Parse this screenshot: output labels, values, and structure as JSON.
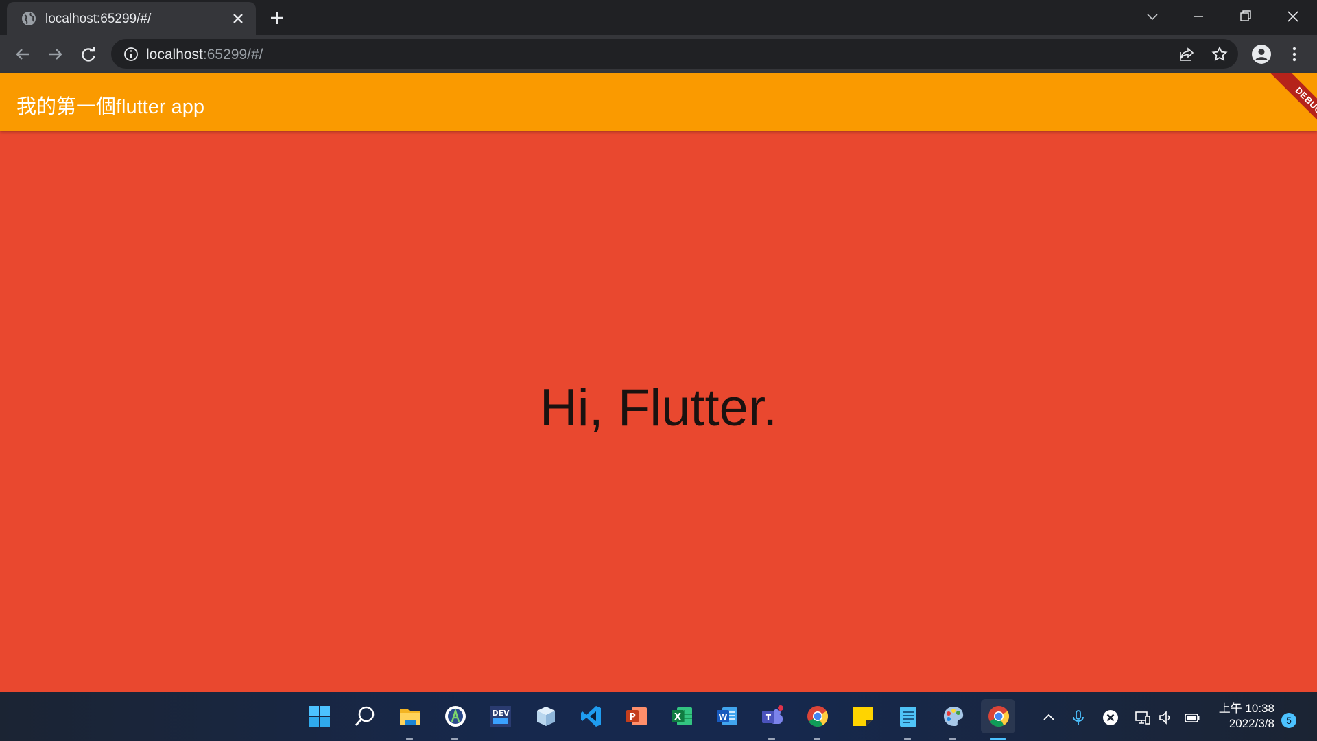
{
  "browser": {
    "tab_title": "localhost:65299/#/",
    "url_host": "localhost",
    "url_path": ":65299/#/"
  },
  "app": {
    "appbar_title": "我的第一個flutter app",
    "debug_banner": "DEBUG",
    "body_text": "Hi, Flutter.",
    "colors": {
      "appbar": "#fa9a00",
      "body": "#e9482f",
      "debug_ribbon": "#b5231b"
    }
  },
  "taskbar": {
    "apps": [
      {
        "name": "start-icon"
      },
      {
        "name": "search-icon"
      },
      {
        "name": "file-explorer-icon"
      },
      {
        "name": "android-studio-icon"
      },
      {
        "name": "dev-tool-icon"
      },
      {
        "name": "3d-box-icon"
      },
      {
        "name": "vscode-icon"
      },
      {
        "name": "powerpoint-icon"
      },
      {
        "name": "excel-icon"
      },
      {
        "name": "word-icon"
      },
      {
        "name": "teams-icon"
      },
      {
        "name": "chrome-icon"
      },
      {
        "name": "sticky-notes-icon"
      },
      {
        "name": "notepad-icon"
      },
      {
        "name": "paint-icon"
      },
      {
        "name": "chrome-active-icon"
      }
    ],
    "clock_time": "上午 10:38",
    "clock_date": "2022/3/8",
    "notification_count": "5"
  }
}
